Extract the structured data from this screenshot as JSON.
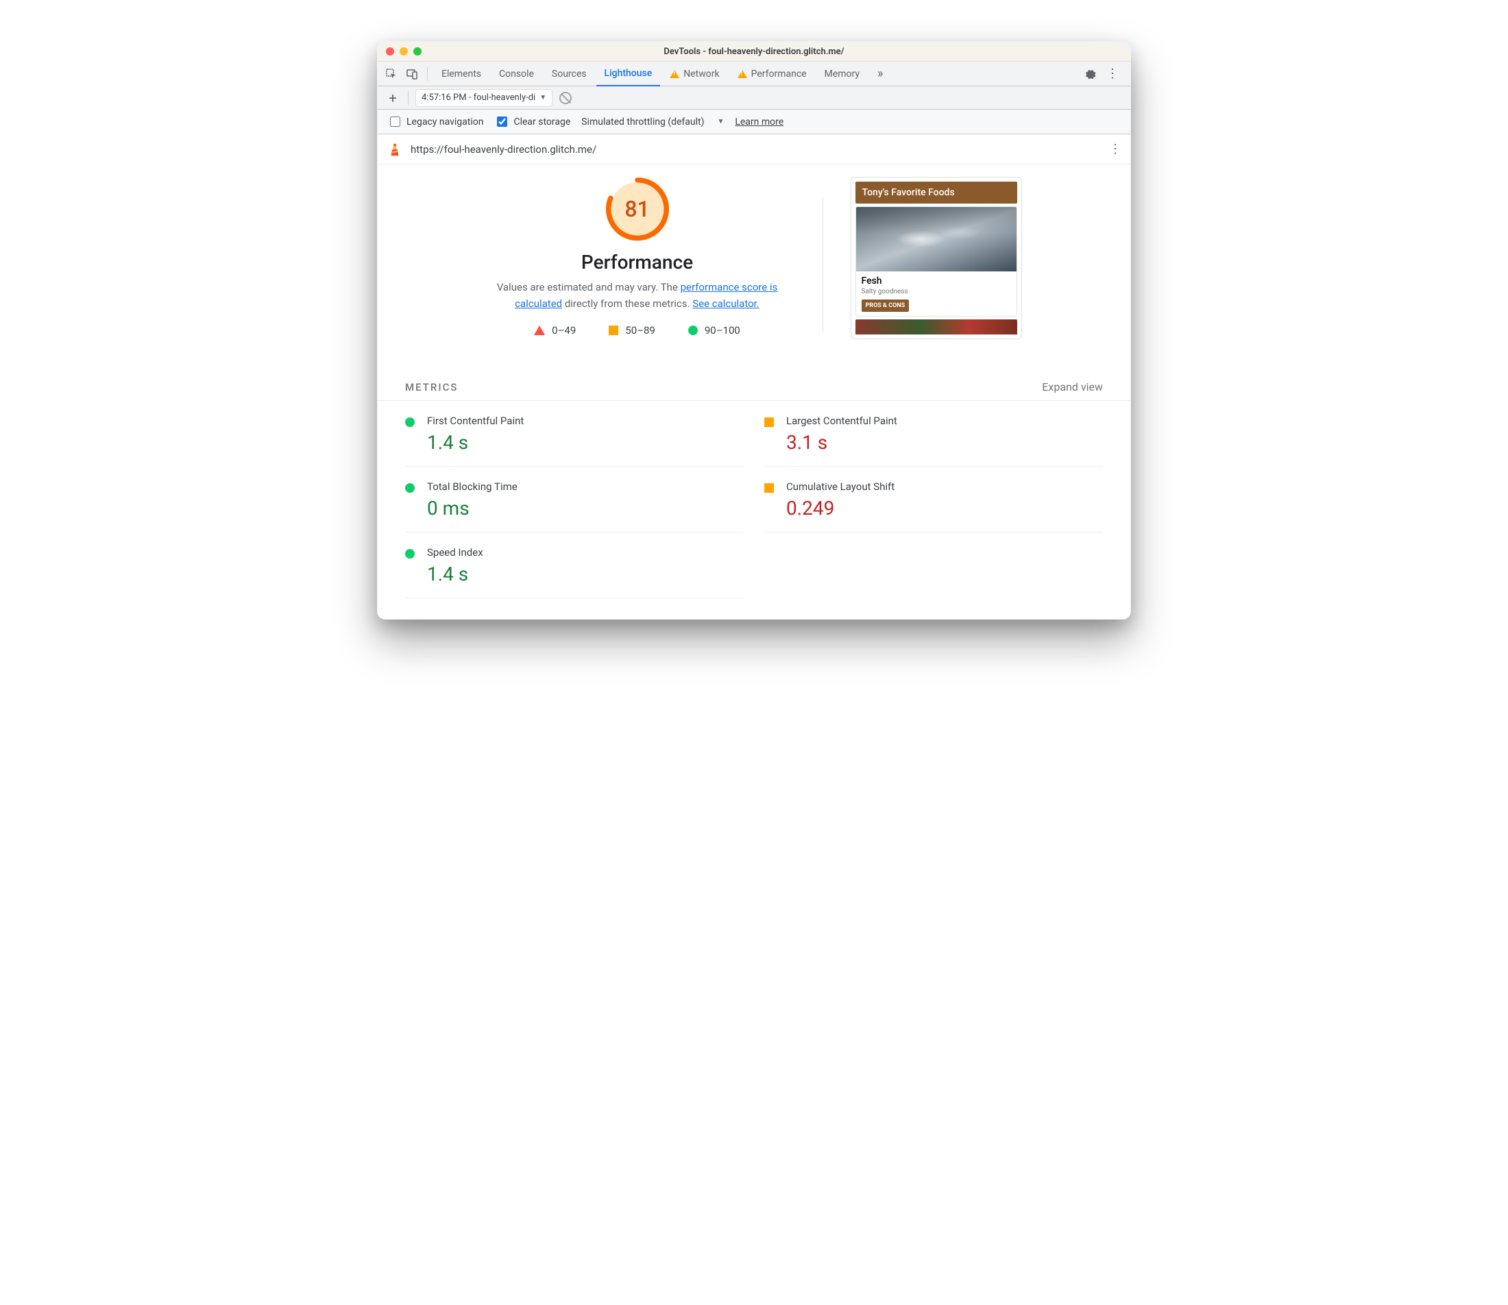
{
  "window": {
    "title": "DevTools - foul-heavenly-direction.glitch.me/"
  },
  "tabs": {
    "items": [
      "Elements",
      "Console",
      "Sources",
      "Lighthouse",
      "Network",
      "Performance",
      "Memory"
    ],
    "active": "Lighthouse",
    "warning_on": [
      "Network",
      "Performance"
    ]
  },
  "subbar": {
    "audit_label": "4:57:16 PM - foul-heavenly-di"
  },
  "options": {
    "legacy_label": "Legacy navigation",
    "clear_label": "Clear storage",
    "throttle_label": "Simulated throttling (default)",
    "learn_more": "Learn more"
  },
  "urlbar": {
    "url": "https://foul-heavenly-direction.glitch.me/"
  },
  "gauge": {
    "score": "81",
    "category": "Performance",
    "desc_pre": "Values are estimated and may vary. The ",
    "link1": "performance score is calculated",
    "desc_mid": " directly from these metrics. ",
    "link2": "See calculator."
  },
  "legend": {
    "fail": "0–49",
    "avg": "50–89",
    "pass": "90–100"
  },
  "preview": {
    "header": "Tony's Favorite Foods",
    "card_title": "Fesh",
    "card_sub": "Salty goodness",
    "card_btn": "PROS & CONS"
  },
  "metrics": {
    "heading": "METRICS",
    "expand": "Expand view",
    "items": [
      {
        "label": "First Contentful Paint",
        "value": "1.4 s",
        "status": "green",
        "shape": "circle"
      },
      {
        "label": "Largest Contentful Paint",
        "value": "3.1 s",
        "status": "red",
        "shape": "square"
      },
      {
        "label": "Total Blocking Time",
        "value": "0 ms",
        "status": "green",
        "shape": "circle"
      },
      {
        "label": "Cumulative Layout Shift",
        "value": "0.249",
        "status": "red",
        "shape": "square"
      },
      {
        "label": "Speed Index",
        "value": "1.4 s",
        "status": "green",
        "shape": "circle"
      }
    ]
  }
}
